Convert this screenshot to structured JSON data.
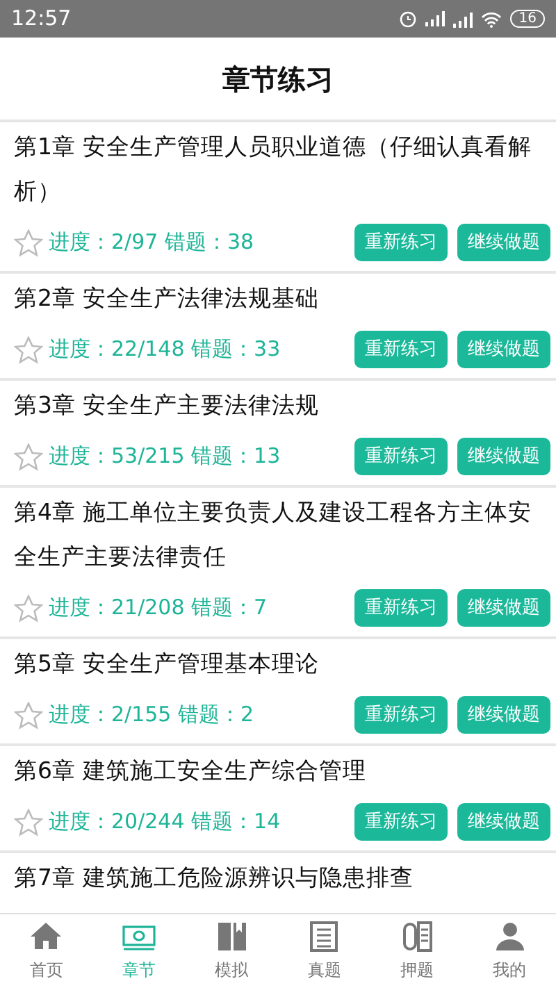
{
  "status_bar": {
    "time": "12:57",
    "battery": "16"
  },
  "header": {
    "title": "章节练习"
  },
  "chapters": [
    {
      "title": "第1章 安全生产管理人员职业道德（仔细认真看解析）",
      "starred": false,
      "progress": "进度：2/97 错题：38",
      "buttons": [
        "重新练习",
        "继续做题"
      ]
    },
    {
      "title": "第2章 安全生产法律法规基础",
      "starred": false,
      "progress": "进度：22/148 错题：33",
      "buttons": [
        "重新练习",
        "继续做题"
      ]
    },
    {
      "title": "第3章 安全生产主要法律法规",
      "starred": false,
      "progress": "进度：53/215 错题：13",
      "buttons": [
        "重新练习",
        "继续做题"
      ]
    },
    {
      "title": "第4章 施工单位主要负责人及建设工程各方主体安全生产主要法律责任",
      "starred": false,
      "progress": "进度：21/208 错题：7",
      "buttons": [
        "重新练习",
        "继续做题"
      ]
    },
    {
      "title": "第5章 安全生产管理基本理论",
      "starred": false,
      "progress": "进度：2/155 错题：2",
      "buttons": [
        "重新练习",
        "继续做题"
      ]
    },
    {
      "title": "第6章 建筑施工安全生产综合管理",
      "starred": false,
      "progress": "进度：20/244 错题：14",
      "buttons": [
        "重新练习",
        "继续做题"
      ]
    },
    {
      "title": "第7章 建筑施工危险源辨识与隐患排查"
    }
  ],
  "tabs": [
    {
      "kind": "home",
      "label": "首页",
      "selected": false
    },
    {
      "kind": "money",
      "label": "章节",
      "selected": true
    },
    {
      "kind": "book",
      "label": "模拟",
      "selected": false
    },
    {
      "kind": "document",
      "label": "真题",
      "selected": false
    },
    {
      "kind": "pen",
      "label": "押题",
      "selected": false
    },
    {
      "kind": "person",
      "label": "我的",
      "selected": false
    }
  ]
}
